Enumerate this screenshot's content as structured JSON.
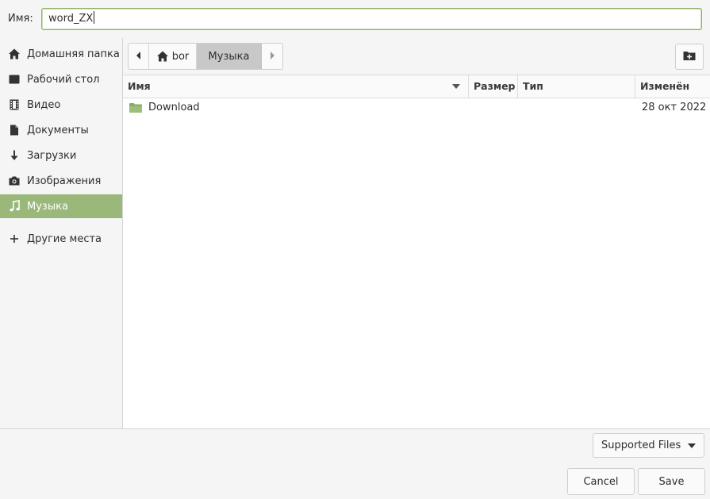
{
  "namebar": {
    "label": "Имя:",
    "value": "word_ZX"
  },
  "sidebar": {
    "items": [
      {
        "label": "Домашняя папка",
        "icon": "home-icon"
      },
      {
        "label": "Рабочий стол",
        "icon": "desktop-icon"
      },
      {
        "label": "Видео",
        "icon": "film-icon"
      },
      {
        "label": "Документы",
        "icon": "document-icon"
      },
      {
        "label": "Загрузки",
        "icon": "download-arrow-icon"
      },
      {
        "label": "Изображения",
        "icon": "camera-icon"
      },
      {
        "label": "Музыка",
        "icon": "music-note-icon",
        "active": true
      }
    ],
    "other": {
      "label": "Другие места",
      "icon": "plus-icon"
    }
  },
  "pathbar": {
    "home": "bor",
    "current": "Музыка"
  },
  "columns": {
    "name": "Имя",
    "size": "Размер",
    "type": "Тип",
    "modified": "Изменён"
  },
  "files": [
    {
      "name": "Download",
      "size": "",
      "type": "",
      "modified": "28 окт 2022",
      "icon": "folder-icon"
    }
  ],
  "filter": {
    "selected": "Supported Files"
  },
  "buttons": {
    "cancel": "Cancel",
    "save": "Save"
  },
  "colors": {
    "accent": "#9ab87a",
    "folder": "#86a965"
  }
}
